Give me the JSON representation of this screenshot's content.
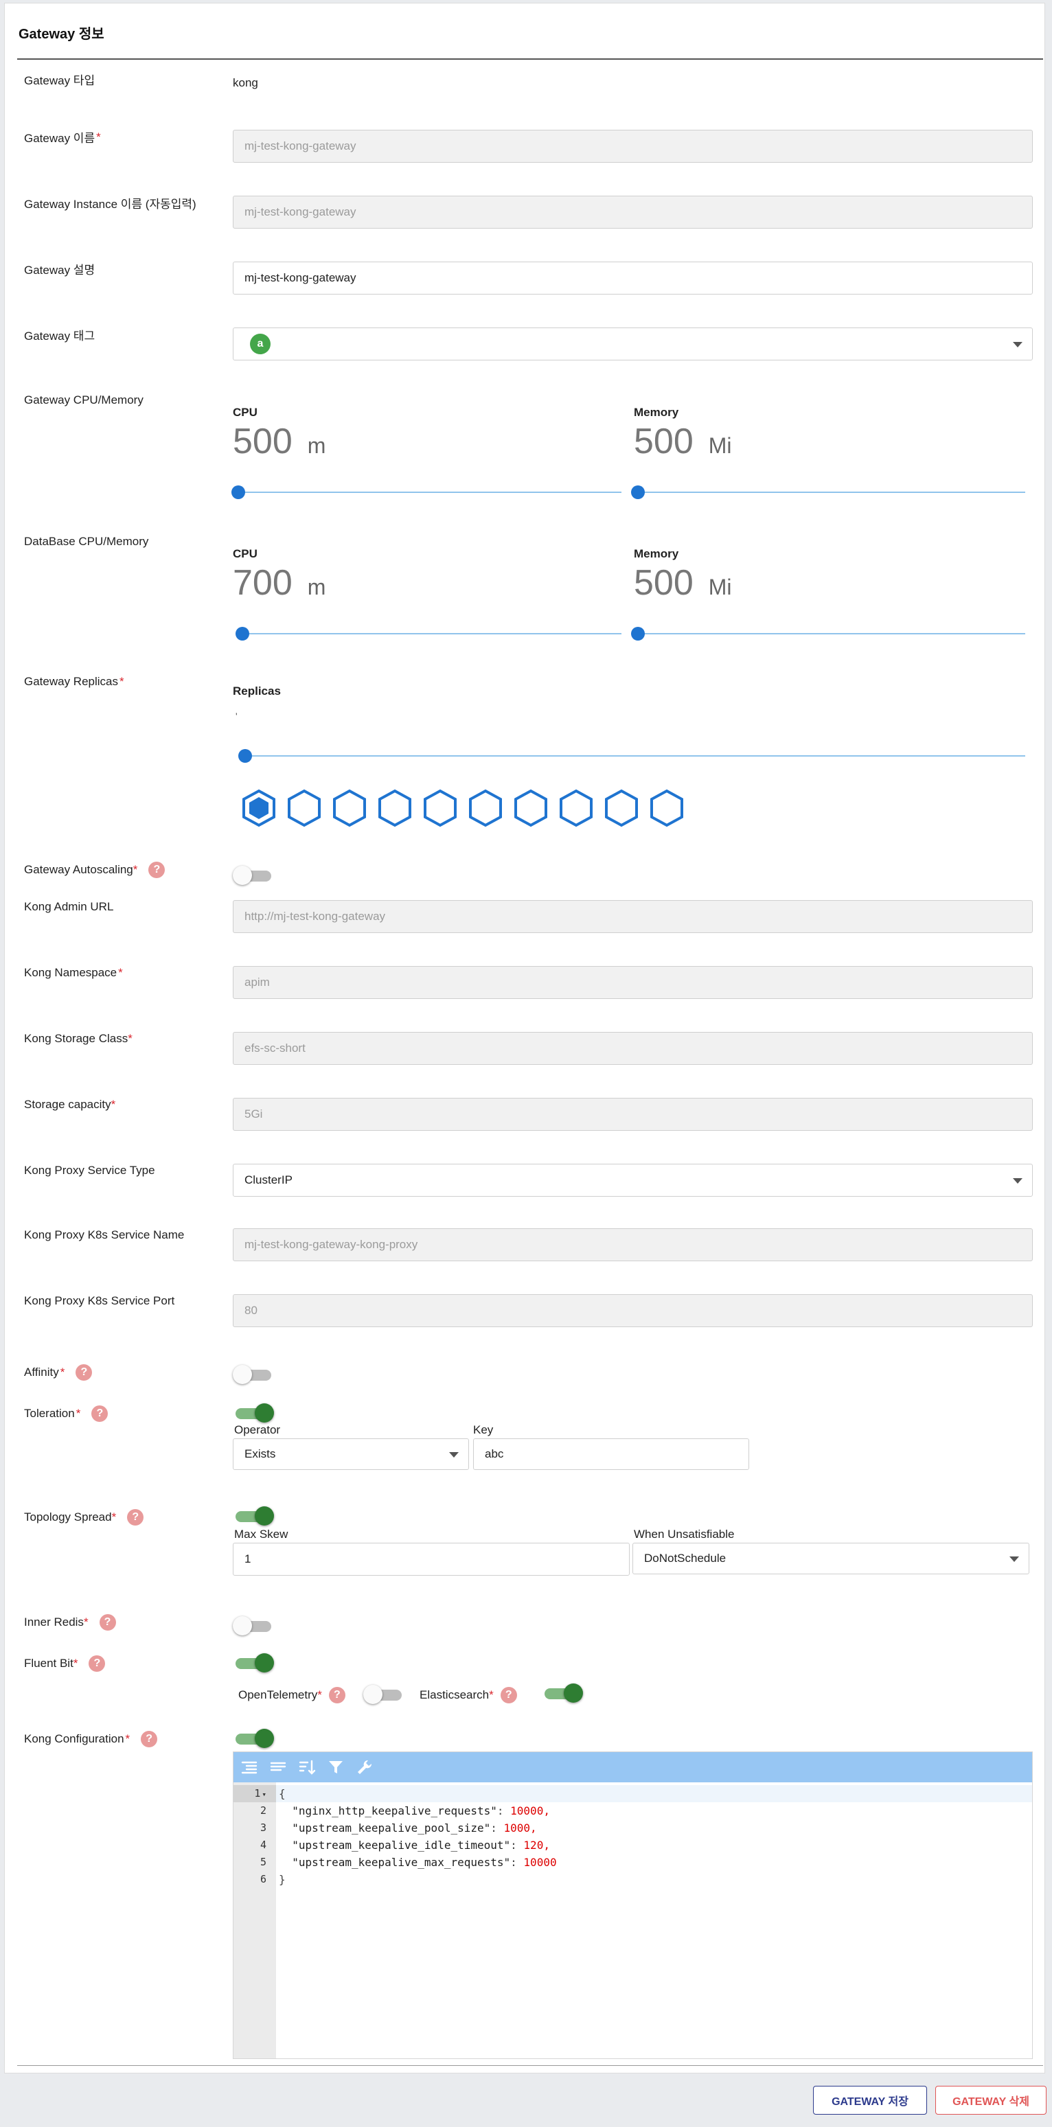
{
  "card_title": "Gateway 정보",
  "gateway_type": {
    "label": "Gateway 타입",
    "value": "kong"
  },
  "gateway_name": {
    "label": "Gateway 이름",
    "required": "*",
    "value": "mj-test-kong-gateway"
  },
  "gateway_instance_name": {
    "label": "Gateway Instance 이름 (자동입력)",
    "value": "mj-test-kong-gateway"
  },
  "gateway_description": {
    "label": "Gateway 설명",
    "value": "mj-test-kong-gateway"
  },
  "gateway_tag": {
    "label": "Gateway 태그",
    "chip": "a"
  },
  "gateway_resources": {
    "label": "Gateway CPU/Memory",
    "cpu": {
      "title": "CPU",
      "value": "500",
      "unit": "m",
      "level": 0.0
    },
    "memory": {
      "title": "Memory",
      "value": "500",
      "unit": "Mi",
      "level": 0.0
    }
  },
  "database_resources": {
    "label": "DataBase CPU/Memory",
    "cpu": {
      "title": "CPU",
      "value": "700",
      "unit": "m",
      "level": 0.01
    },
    "memory": {
      "title": "Memory",
      "value": "500",
      "unit": "Mi",
      "level": 0.0
    }
  },
  "replicas": {
    "label": "Gateway Replicas",
    "required": "*",
    "title": "Replicas",
    "value_mark": "'",
    "selected": 1,
    "total": 10,
    "level": 0.0,
    "color": "#1f74d0"
  },
  "autoscaling": {
    "label": "Gateway Autoscaling",
    "required": "*",
    "help": "?",
    "on": false
  },
  "kong_admin_url": {
    "label": "Kong Admin URL",
    "value": "http://mj-test-kong-gateway"
  },
  "kong_namespace": {
    "label": "Kong Namespace",
    "required": "*",
    "value": "apim"
  },
  "kong_storage_class": {
    "label": "Kong Storage Class",
    "required": "*",
    "value": "efs-sc-short"
  },
  "storage_capacity": {
    "label": "Storage capacity",
    "required": "*",
    "value": "5Gi"
  },
  "proxy_service_type": {
    "label": "Kong Proxy Service Type",
    "value": "ClusterIP"
  },
  "proxy_service_name": {
    "label": "Kong Proxy K8s Service Name",
    "value": "mj-test-kong-gateway-kong-proxy"
  },
  "proxy_service_port": {
    "label": "Kong Proxy K8s Service Port",
    "value": "80"
  },
  "affinity": {
    "label": "Affinity",
    "required": "*",
    "help": "?",
    "on": false
  },
  "toleration": {
    "label": "Toleration",
    "required": "*",
    "help": "?",
    "on": true,
    "operator_label": "Operator",
    "operator_value": "Exists",
    "key_label": "Key",
    "key_value": "abc"
  },
  "topology_spread": {
    "label": "Topology Spread",
    "required": "*",
    "help": "?",
    "on": true,
    "max_skew_label": "Max Skew",
    "max_skew_value": "1",
    "unsatisfiable_label": "When Unsatisfiable",
    "unsatisfiable_value": "DoNotSchedule"
  },
  "inner_redis": {
    "label": "Inner Redis",
    "required": "*",
    "help": "?",
    "on": false
  },
  "fluent_bit": {
    "label": "Fluent Bit",
    "required": "*",
    "help": "?",
    "on": true
  },
  "open_telemetry": {
    "label": "OpenTelemetry",
    "required": "*",
    "help": "?",
    "on": false
  },
  "elasticsearch": {
    "label": "Elasticsearch",
    "required": "*",
    "help": "?",
    "on": true
  },
  "kong_configuration": {
    "label": "Kong Configuration",
    "required": "*",
    "help": "?",
    "on": true,
    "toolbar_icons": [
      "format-icon",
      "compact-icon",
      "sort-icon",
      "filter-icon",
      "repair-icon"
    ],
    "lines": [
      {
        "num": "1",
        "fold": "▾",
        "text": "{"
      },
      {
        "num": "2",
        "key": "\"nginx_http_keepalive_requests\"",
        "value": "10000",
        "suffix": ","
      },
      {
        "num": "3",
        "key": "\"upstream_keepalive_pool_size\"",
        "value": "1000",
        "suffix": ","
      },
      {
        "num": "4",
        "key": "\"upstream_keepalive_idle_timeout\"",
        "value": "120",
        "suffix": ","
      },
      {
        "num": "5",
        "key": "\"upstream_keepalive_max_requests\"",
        "value": "10000",
        "suffix": ""
      },
      {
        "num": "6",
        "text": "}"
      }
    ]
  },
  "buttons": {
    "save": "GATEWAY 저장",
    "delete": "GATEWAY 삭제"
  },
  "colors": {
    "accent": "#1f74d0",
    "toggle_on": "#2e7d32",
    "required": "#d9262e",
    "help": "#e89a9a",
    "editor_toolbar": "#97c6f3"
  }
}
